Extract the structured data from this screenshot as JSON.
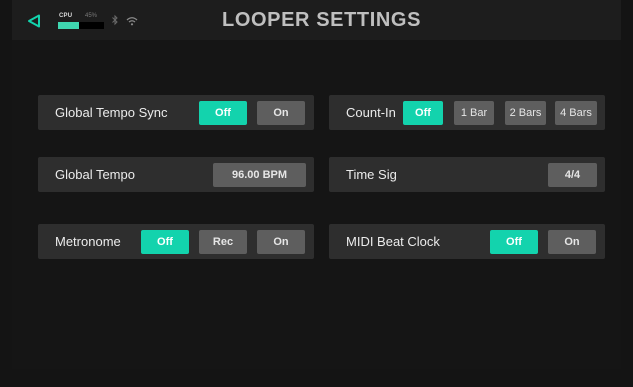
{
  "colors": {
    "accent": "#13d3ad",
    "panel": "#2e2e2e",
    "button": "#5e5e5e",
    "background": "#151515"
  },
  "status_bar": {
    "back_icon": "back-triangle-icon",
    "cpu_label": "CPU",
    "cpu_percent_text": "45%",
    "cpu_load": 0.45,
    "bluetooth_icon": "bluetooth-icon",
    "wifi_icon": "wifi-icon"
  },
  "title": "LOOPER SETTINGS",
  "settings": {
    "global_tempo_sync": {
      "label": "Global Tempo Sync",
      "options": [
        "Off",
        "On"
      ],
      "selected": "Off"
    },
    "count_in": {
      "label": "Count-In",
      "options": [
        "Off",
        "1 Bar",
        "2 Bars",
        "4 Bars"
      ],
      "selected": "Off"
    },
    "global_tempo": {
      "label": "Global Tempo",
      "value": "96.00 BPM"
    },
    "time_sig": {
      "label": "Time Sig",
      "value": "4/4"
    },
    "metronome": {
      "label": "Metronome",
      "options": [
        "Off",
        "Rec",
        "On"
      ],
      "selected": "Off"
    },
    "midi_beat_clock": {
      "label": "MIDI Beat Clock",
      "options": [
        "Off",
        "On"
      ],
      "selected": "Off"
    }
  }
}
